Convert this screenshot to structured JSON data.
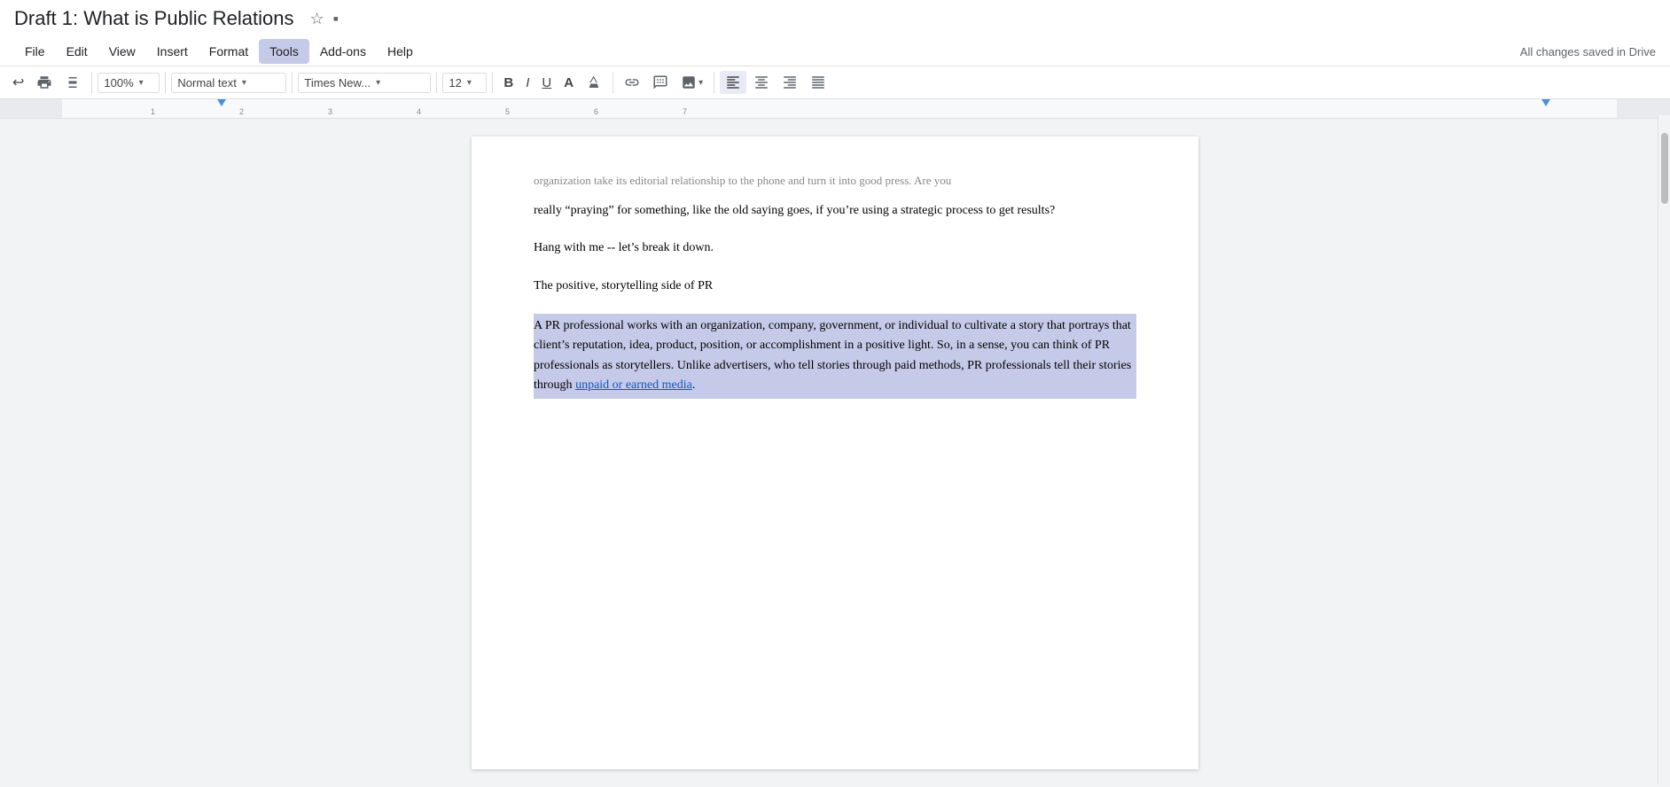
{
  "title_bar": {
    "doc_title": "Draft 1: What is Public Relations",
    "star_icon": "☆",
    "folder_icon": "▪"
  },
  "menu_bar": {
    "items": [
      "File",
      "Edit",
      "View",
      "Insert",
      "Format",
      "Tools",
      "Add-ons",
      "Help"
    ],
    "active_item": "Tools",
    "status": "All changes saved in Drive"
  },
  "toolbar": {
    "undo_icon": "↩",
    "print_icon": "🖨",
    "paint_format_icon": "🖌",
    "zoom_label": "100%",
    "zoom_chevron": "▾",
    "text_style_label": "Normal text",
    "text_style_chevron": "▾",
    "font_label": "Times New...",
    "font_chevron": "▾",
    "font_size": "12",
    "font_size_chevron": "▾",
    "bold": "B",
    "italic": "I",
    "underline": "U",
    "font_color": "A",
    "highlight": "✏",
    "link": "🔗",
    "comment": "+",
    "image": "🖼",
    "align_left": "≡",
    "align_center": "≡",
    "align_right": "≡",
    "align_justify": "≡"
  },
  "ruler": {
    "numbers": [
      "1",
      "2",
      "3",
      "4",
      "5",
      "6",
      "7"
    ]
  },
  "document": {
    "cut_top_text": "organization take its editorial relationship to the phone and turn it into good press. Are you",
    "paragraph1": "really “praying” for something, like the old saying goes, if you’re using a strategic process to get results?",
    "paragraph2": "Hang with me -- let’s break it down.",
    "paragraph3": "The positive, storytelling side of PR",
    "highlighted_text": "A PR professional works with an organization, company, government, or individual to cultivate a story that portrays that client’s reputation, idea, product, position, or accomplishment in a positive light. So, in a sense, you can think of PR professionals as storytellers. Unlike advertisers, who tell stories through paid methods, PR professionals tell their stories through ",
    "link_text": "unpaid or earned media",
    "period": ".",
    "bottom_cut_text": ""
  }
}
